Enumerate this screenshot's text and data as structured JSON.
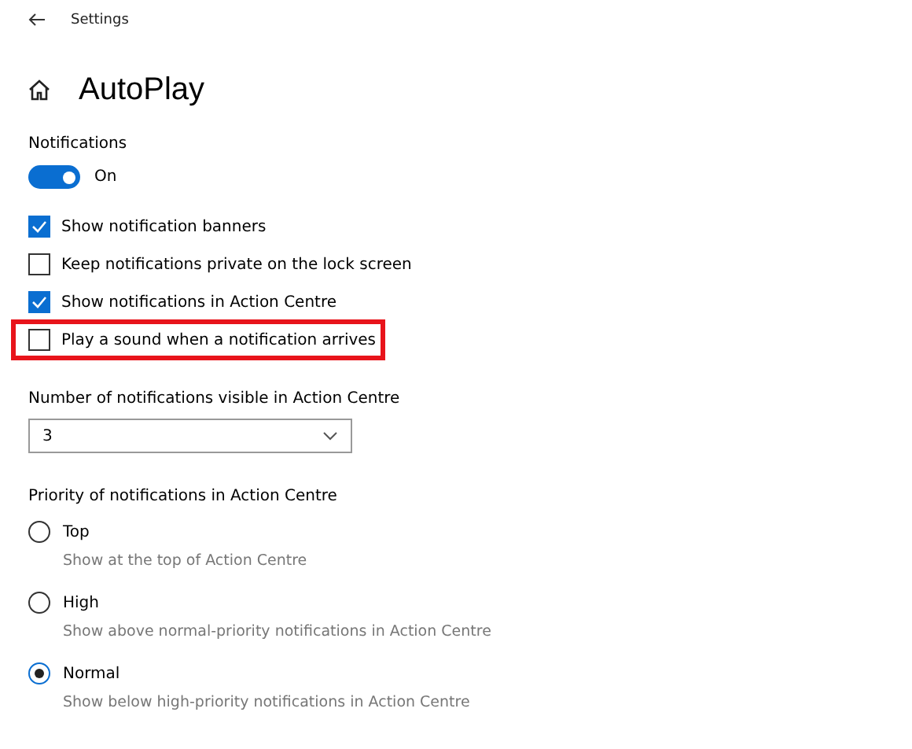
{
  "header": {
    "title": "Settings"
  },
  "page": {
    "title": "AutoPlay"
  },
  "notifications": {
    "label": "Notifications",
    "toggle": {
      "on": true,
      "label": "On"
    }
  },
  "checkboxes": [
    {
      "label": "Show notification banners",
      "checked": true,
      "highlighted": false
    },
    {
      "label": "Keep notifications private on the lock screen",
      "checked": false,
      "highlighted": false
    },
    {
      "label": "Show notifications in Action Centre",
      "checked": true,
      "highlighted": false
    },
    {
      "label": "Play a sound when a notification arrives",
      "checked": false,
      "highlighted": true
    }
  ],
  "count": {
    "label": "Number of notifications visible in Action Centre",
    "value": "3"
  },
  "priority": {
    "label": "Priority of notifications in Action Centre",
    "options": [
      {
        "label": "Top",
        "description": "Show at the top of Action Centre",
        "selected": false
      },
      {
        "label": "High",
        "description": "Show above normal-priority notifications in Action Centre",
        "selected": false
      },
      {
        "label": "Normal",
        "description": "Show below high-priority notifications in Action Centre",
        "selected": true
      }
    ]
  }
}
